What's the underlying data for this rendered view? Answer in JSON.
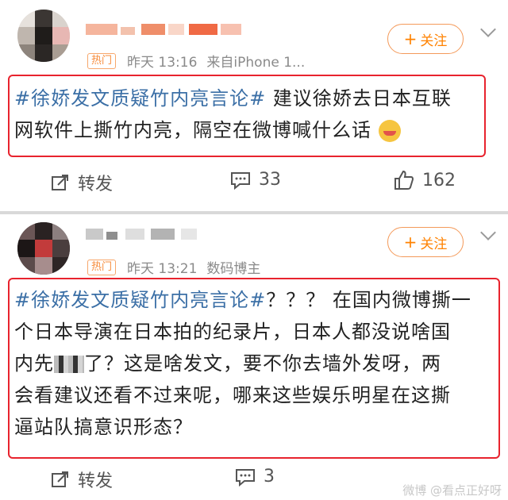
{
  "posts": [
    {
      "badge": "热门",
      "time": "昨天 13:16",
      "source": "来自iPhone 1...",
      "follow_label": "关注",
      "text": {
        "hashtag": "#徐娇发文质疑竹内亮言论#",
        "line1_rest": " 建议徐娇去日本互联",
        "line2": "网软件上撕竹内亮，隔空在微博喊什么话"
      },
      "actions": {
        "repost": "转发",
        "comments": "33",
        "likes": "162"
      }
    },
    {
      "badge": "热门",
      "time": "昨天 13:21",
      "source": "数码博主",
      "follow_label": "关注",
      "text": {
        "hashtag": "#徐娇发文质疑竹内亮言论#",
        "line1_rest": "？？？ 在国内微博撕一",
        "line2": "个日本导演在日本拍的纪录片，日本人都没说啥国",
        "line3_a": "内先",
        "line3_b": "了？这是啥发文，要不你去墙外发呀，两",
        "line4": "会看建议还看不过来呢，哪来这些娱乐明星在这撕",
        "line5": "逼站队搞意识形态？"
      },
      "actions": {
        "repost": "转发",
        "comments": "3"
      }
    }
  ],
  "watermark": "微博 @看点正好呀"
}
